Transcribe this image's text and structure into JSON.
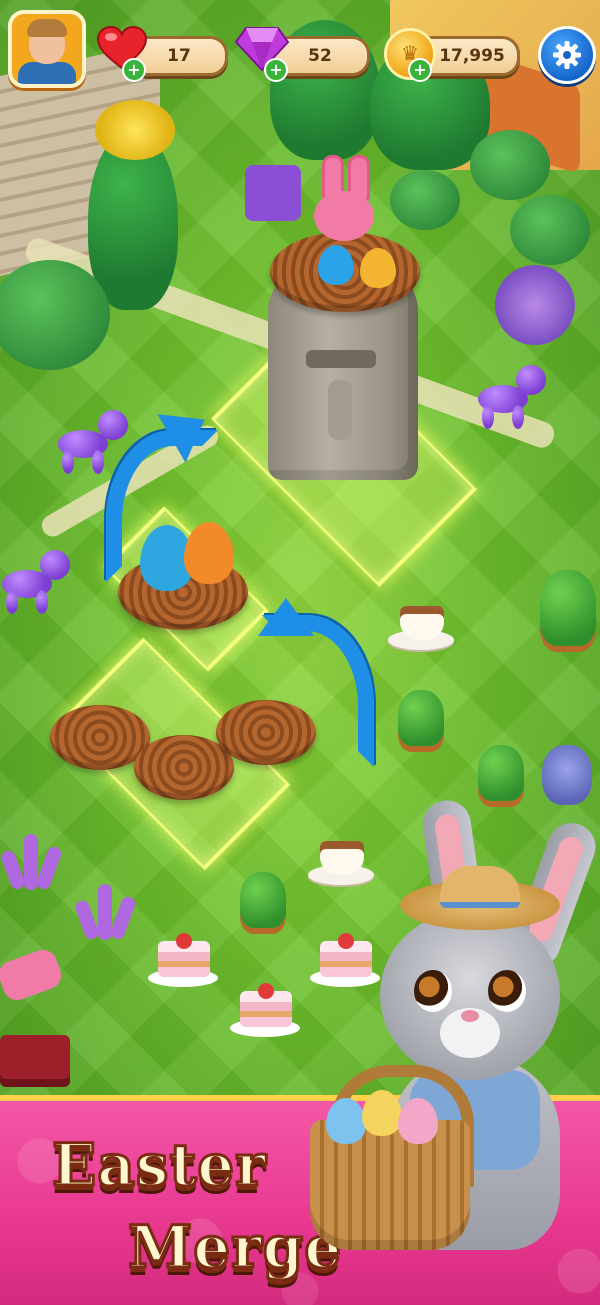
{
  "hud": {
    "lives": "17",
    "gems": "52",
    "coins": "17,995",
    "add_symbol": "+"
  },
  "banner": {
    "title_line1": "Easter",
    "title_line2": "Merge"
  },
  "icons": {
    "avatar": "player-avatar",
    "lives": "heart-icon",
    "gems": "gem-icon",
    "coins": "coin-icon",
    "settings": "gear-icon"
  },
  "colors": {
    "grass": "#6cbf2c",
    "banner": "#e8388f",
    "glow": "#f4ff80",
    "arrow": "#1f8ee6",
    "plus": "#38b43a"
  }
}
